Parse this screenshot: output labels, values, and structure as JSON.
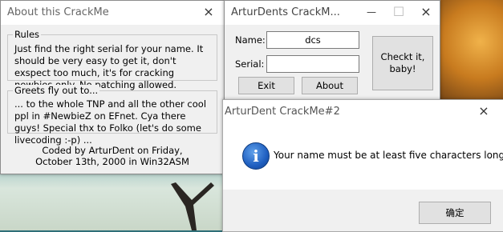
{
  "about": {
    "title": "About this CrackMe",
    "rules": {
      "title": "Rules",
      "text": "Just find the right serial for your name. It should be very easy to get it, don't exspect too much, it's for cracking newbies only. No patching allowed."
    },
    "greets": {
      "title": "Greets fly out to...",
      "text": "... to the whole TNP and all the other cool ppl in #NewbieZ on EFnet. Cya there guys! Special thx to Folko (let's do some livecoding :-p) ..."
    },
    "coded_by": "Coded by ArturDent on Friday, October 13th, 2000 in Win32ASM"
  },
  "main": {
    "title": "ArturDents CrackM...",
    "name_label": "Name:",
    "name_value": "dcs",
    "serial_label": "Serial:",
    "serial_value": "",
    "exit_label": "Exit",
    "about_label": "About",
    "check_label_line1": "Checkt it,",
    "check_label_line2": "baby!"
  },
  "message": {
    "title": "ArturDent CrackMe#2",
    "text": "Your name must be at least five characters long!",
    "ok_label": "确定"
  },
  "icons": {
    "close": "×",
    "minimize": "—",
    "maximize": "☐",
    "info": "i"
  }
}
